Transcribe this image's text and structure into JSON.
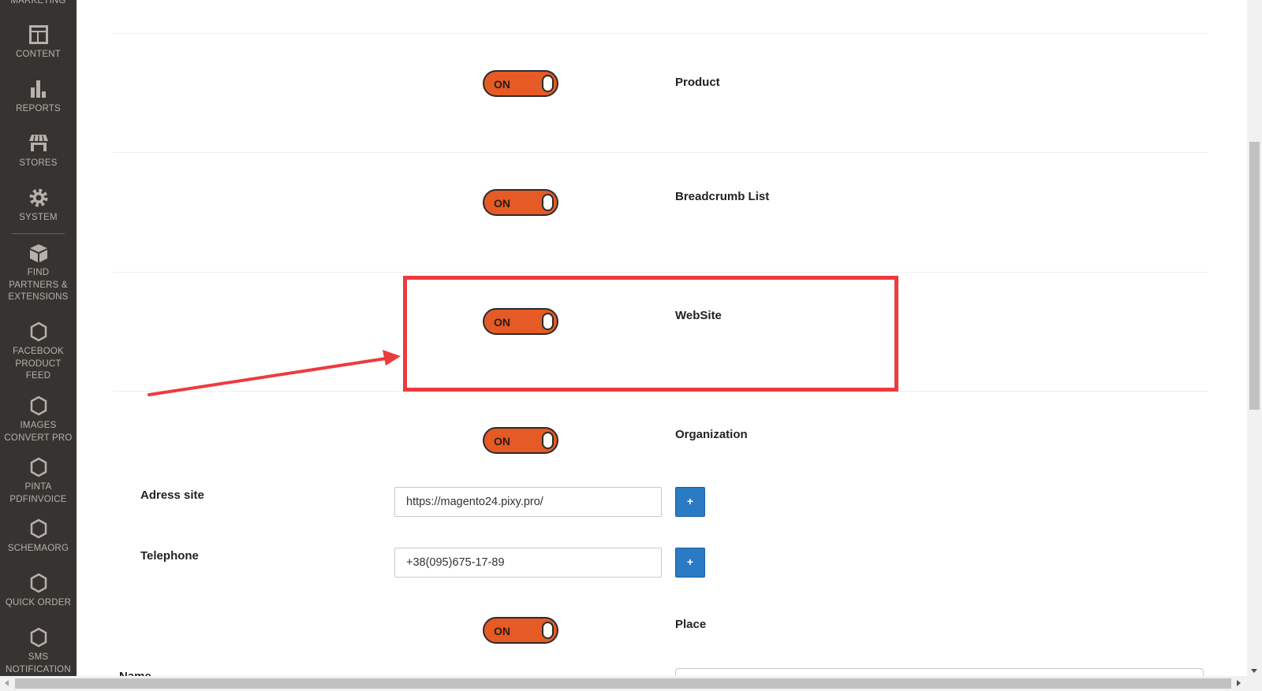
{
  "sidebar": {
    "items": [
      {
        "label": "MARKETING",
        "icon": "megaphone-icon"
      },
      {
        "label": "CONTENT",
        "icon": "layout-icon"
      },
      {
        "label": "REPORTS",
        "icon": "bar-chart-icon"
      },
      {
        "label": "STORES",
        "icon": "storefront-icon"
      },
      {
        "label": "SYSTEM",
        "icon": "gear-icon"
      },
      {
        "label": "FIND PARTNERS & EXTENSIONS",
        "icon": "box-icon"
      },
      {
        "label": "FACEBOOK PRODUCT FEED",
        "icon": "hexagon-icon"
      },
      {
        "label": "IMAGES CONVERT PRO",
        "icon": "hexagon-icon"
      },
      {
        "label": "PINTA PDFINVOICE",
        "icon": "hexagon-icon"
      },
      {
        "label": "SCHEMAORG",
        "icon": "hexagon-icon"
      },
      {
        "label": "QUICK ORDER",
        "icon": "hexagon-icon"
      },
      {
        "label": "SMS NOTIFICATION",
        "icon": "hexagon-icon"
      }
    ]
  },
  "rows": [
    {
      "title": "Product",
      "toggle": "ON"
    },
    {
      "title": "Breadcrumb List",
      "toggle": "ON"
    },
    {
      "title": "WebSite",
      "toggle": "ON"
    },
    {
      "title": "Organization",
      "toggle": "ON"
    },
    {
      "title": "Place",
      "toggle": "ON"
    }
  ],
  "organization": {
    "address": {
      "label": "Adress site",
      "value": "https://magento24.pixy.pro/",
      "button": "+"
    },
    "telephone": {
      "label": "Telephone",
      "value": "+38(095)675-17-89",
      "button": "+"
    }
  },
  "place": {
    "name_label": "Name"
  },
  "colors": {
    "sidebar_bg": "#373330",
    "toggle_on": "#e65a25",
    "button_blue": "#2b7bc4",
    "highlight_red": "#ec3b3f"
  }
}
